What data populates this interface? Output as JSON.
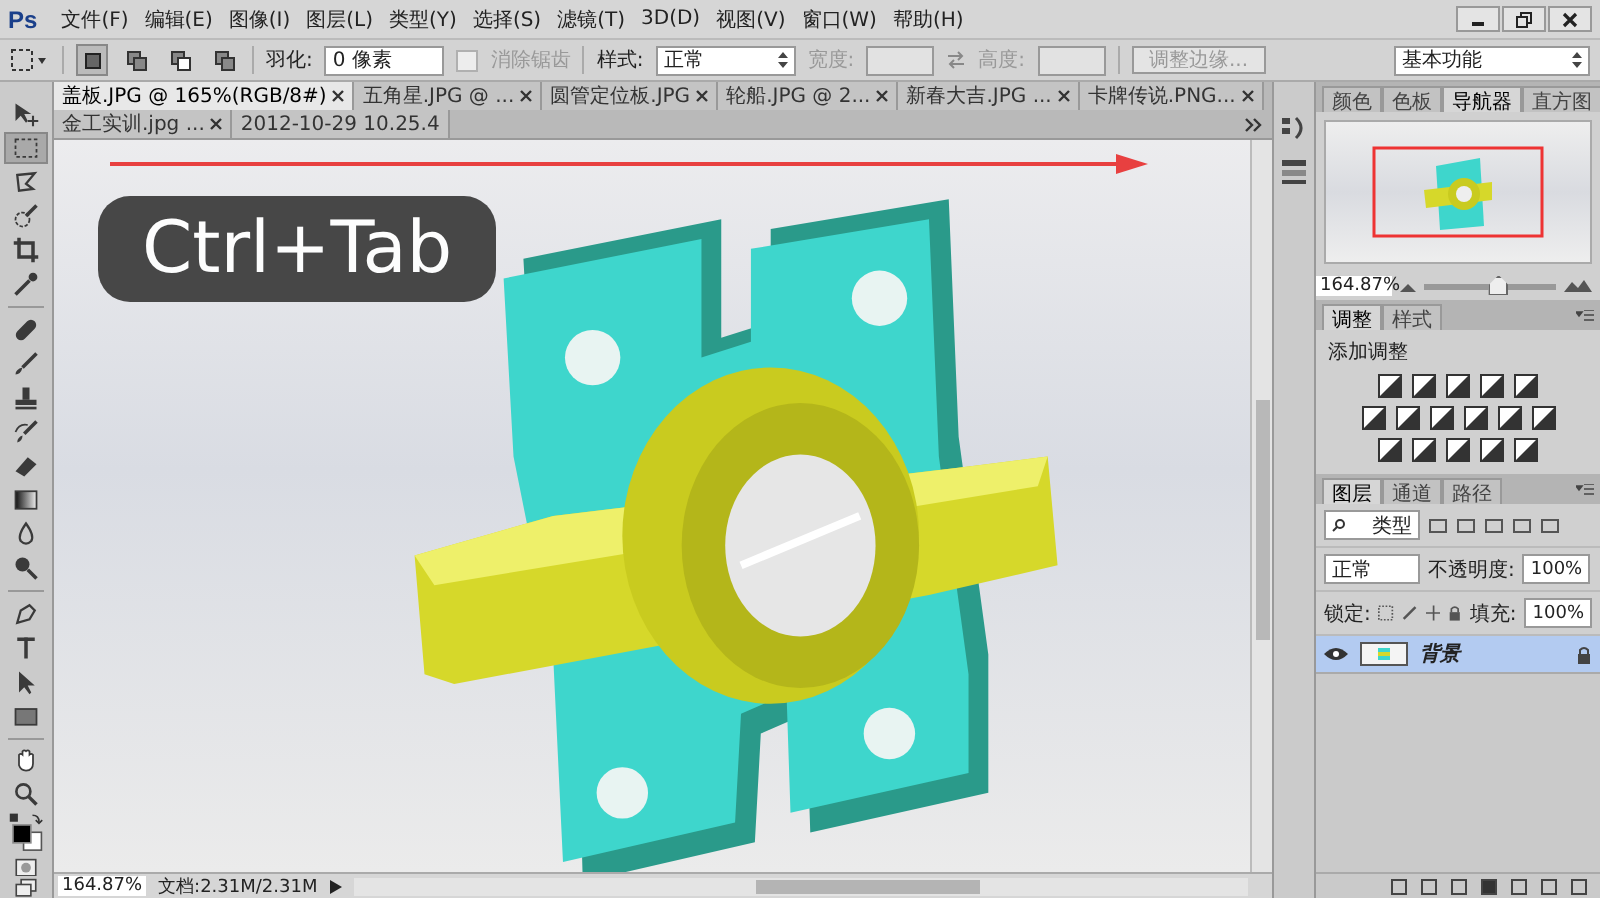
{
  "menu_bar": {
    "logo": "Ps",
    "items": [
      "文件(F)",
      "编辑(E)",
      "图像(I)",
      "图层(L)",
      "类型(Y)",
      "选择(S)",
      "滤镜(T)",
      "3D(D)",
      "视图(V)",
      "窗口(W)",
      "帮助(H)"
    ]
  },
  "options_bar": {
    "feather_label": "羽化:",
    "feather_value": "0 像素",
    "antialias": {
      "label": "消除锯齿",
      "checked": false,
      "disabled": true
    },
    "style_label": "样式:",
    "style_value": "正常",
    "width_field": {
      "label": "宽度:",
      "disabled": true
    },
    "height_field": {
      "label": "高度:",
      "disabled": true
    },
    "refine_edge": {
      "label": "调整边缘...",
      "disabled": true
    },
    "workspace": "基本功能"
  },
  "tools": [
    {
      "kind": "move",
      "selected": false
    },
    {
      "kind": "marquee",
      "selected": true
    },
    {
      "kind": "lasso",
      "selected": false
    },
    {
      "kind": "quick",
      "selected": false
    },
    {
      "kind": "crop",
      "selected": false
    },
    {
      "kind": "eyedropper",
      "selected": false
    },
    {
      "kind": "healing",
      "selected": false
    },
    {
      "kind": "brush",
      "selected": false
    },
    {
      "kind": "stamp",
      "selected": false
    },
    {
      "kind": "history",
      "selected": false
    },
    {
      "kind": "eraser",
      "selected": false
    },
    {
      "kind": "gradient",
      "selected": false
    },
    {
      "kind": "blur",
      "selected": false
    },
    {
      "kind": "dodge",
      "selected": false
    },
    {
      "kind": "pen",
      "selected": false
    },
    {
      "kind": "type",
      "selected": false
    },
    {
      "kind": "pathselect",
      "selected": false
    },
    {
      "kind": "rectangle",
      "selected": false
    },
    {
      "kind": "hand",
      "selected": false
    },
    {
      "kind": "zoom",
      "selected": false
    }
  ],
  "document_tabs": [
    {
      "label": "盖板.JPG @ 165%(RGB/8#)",
      "selected": true
    },
    {
      "label": "五角星.JPG @ ...",
      "selected": false
    },
    {
      "label": "圆管定位板.JPG",
      "selected": false
    },
    {
      "label": "轮船.JPG @ 2...",
      "selected": false
    },
    {
      "label": "新春大吉.JPG ...",
      "selected": false
    },
    {
      "label": "卡牌传说.PNG...",
      "selected": false
    },
    {
      "label": "金工实训.jpg ...",
      "selected": false
    },
    {
      "label": "2012-10-29 10.25.4",
      "selected": false
    }
  ],
  "canvas": {
    "overlay_text": "Ctrl+Tab"
  },
  "status_bar": {
    "zoom": "164.87%",
    "doc_size": "文档:2.31M/2.31M"
  },
  "navigator_panel": {
    "tabs": [
      {
        "label": "颜色",
        "selected": false
      },
      {
        "label": "色板",
        "selected": false
      },
      {
        "label": "导航器",
        "selected": true
      },
      {
        "label": "直方图",
        "selected": false
      }
    ],
    "zoom": "164.87%",
    "level": 0.55
  },
  "adjustments_panel": {
    "tabs": [
      {
        "label": "调整",
        "selected": true
      },
      {
        "label": "样式",
        "selected": false
      }
    ],
    "title": "添加调整"
  },
  "layers_panel": {
    "tabs": [
      {
        "label": "图层",
        "selected": true
      },
      {
        "label": "通道",
        "selected": false
      },
      {
        "label": "路径",
        "selected": false
      }
    ],
    "filter": "类型",
    "blend_mode": "正常",
    "opacity_label": "不透明度:",
    "opacity": "100%",
    "lock_label": "锁定:",
    "fill_label": "填充:",
    "fill": "100%",
    "layers": [
      {
        "name": "背景",
        "visible": true,
        "selected": true,
        "locked": true
      }
    ]
  }
}
